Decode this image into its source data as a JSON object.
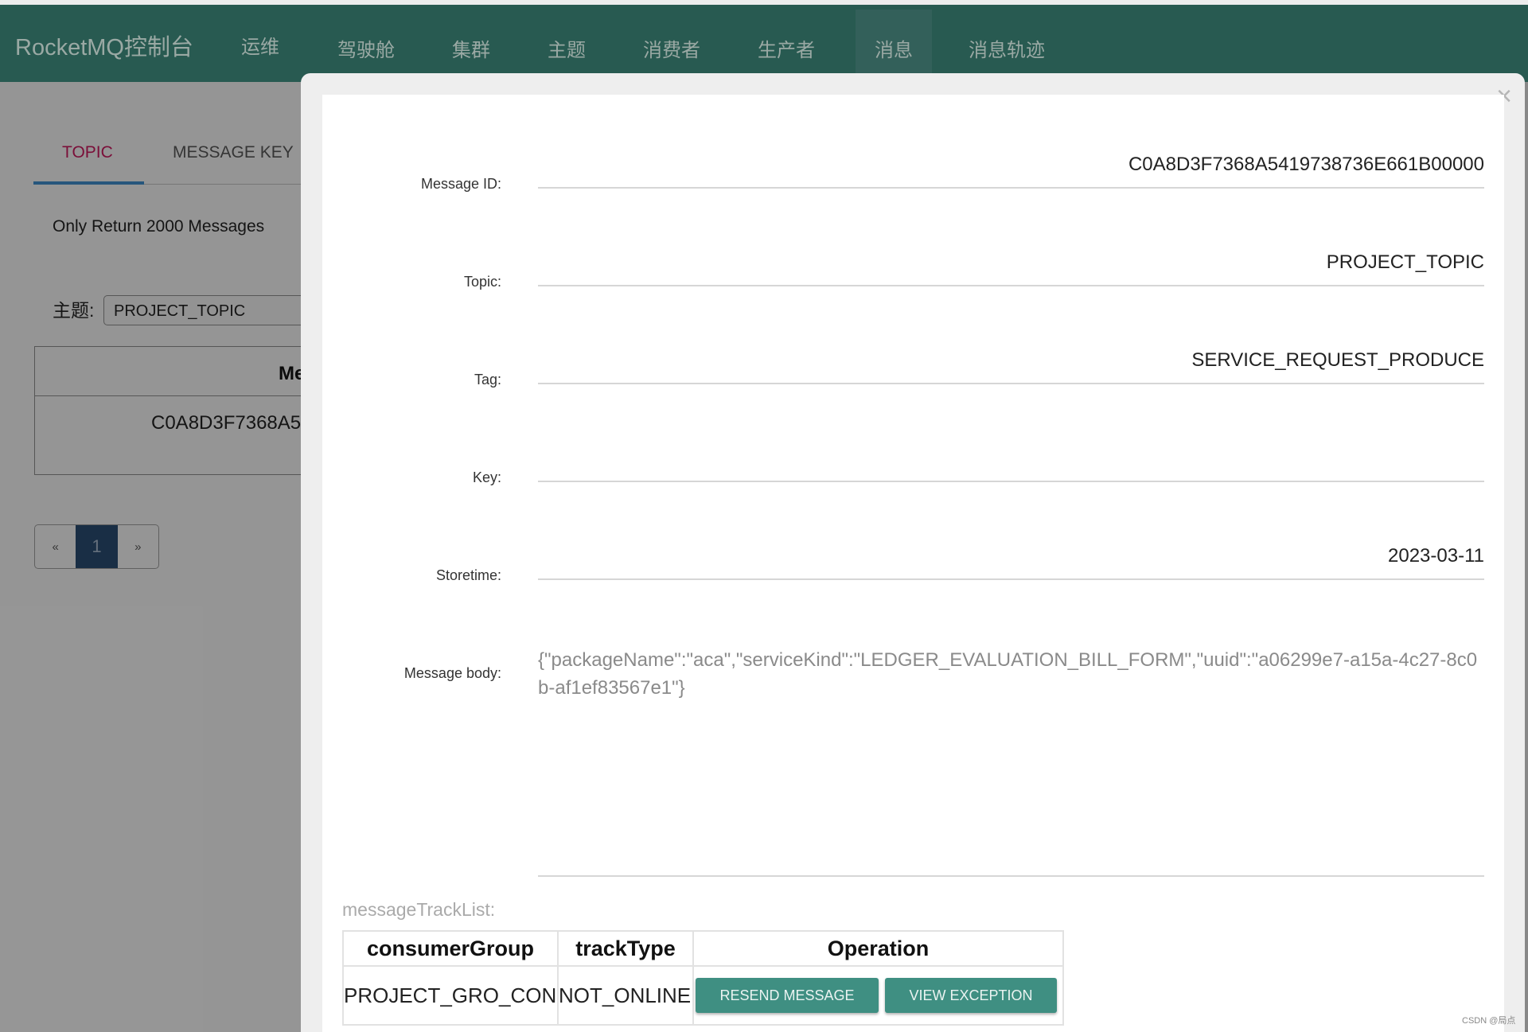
{
  "header": {
    "brand": "RocketMQ控制台",
    "nav": [
      {
        "label": "运维",
        "active": false
      },
      {
        "label": "驾驶舱",
        "active": false
      },
      {
        "label": "集群",
        "active": false
      },
      {
        "label": "主题",
        "active": false
      },
      {
        "label": "消费者",
        "active": false
      },
      {
        "label": "生产者",
        "active": false
      },
      {
        "label": "消息",
        "active": true
      },
      {
        "label": "消息轨迹",
        "active": false
      }
    ]
  },
  "page": {
    "tabs": [
      {
        "label": "TOPIC",
        "active": true
      },
      {
        "label": "MESSAGE KEY",
        "active": false
      }
    ],
    "notice": "Only Return 2000 Messages",
    "topic_label": "主题:",
    "topic_select_value": "PROJECT_TOPIC",
    "table": {
      "header_visible": "Me",
      "rows": [
        {
          "message_id_visible": "C0A8D3F7368A5"
        }
      ]
    },
    "pagination": {
      "prev": "«",
      "current": "1",
      "next": "»"
    }
  },
  "modal": {
    "close_icon": "×",
    "fields": {
      "message_id": {
        "label": "Message ID:",
        "value": "C0A8D3F7368A5419738736E661B00000"
      },
      "topic": {
        "label": "Topic:",
        "value": "PROJECT_TOPIC"
      },
      "tag": {
        "label": "Tag:",
        "value": "SERVICE_REQUEST_PRODUCE"
      },
      "key": {
        "label": "Key:",
        "value": ""
      },
      "storetime": {
        "label": "Storetime:",
        "value": "2023-03-11"
      },
      "body": {
        "label": "Message body:",
        "value": "{\"packageName\":\"aca\",\"serviceKind\":\"LEDGER_EVALUATION_BILL_FORM\",\"uuid\":\"a06299e7-a15a-4c27-8c0b-af1ef83567e1\"}"
      }
    },
    "track": {
      "title": "messageTrackList:",
      "columns": [
        "consumerGroup",
        "trackType",
        "Operation"
      ],
      "rows": [
        {
          "consumerGroup": "PROJECT_GRO_CON",
          "trackType": "NOT_ONLINE",
          "resend_label": "RESEND MESSAGE",
          "exception_label": "VIEW EXCEPTION"
        }
      ]
    }
  },
  "watermark": "CSDN @局点",
  "colors": {
    "header_bg": "#285a51",
    "active_tab": "#c2185b",
    "tab_underline": "#3f88c5",
    "button_bg": "#3f8f82",
    "pager_active": "#284a6e"
  }
}
